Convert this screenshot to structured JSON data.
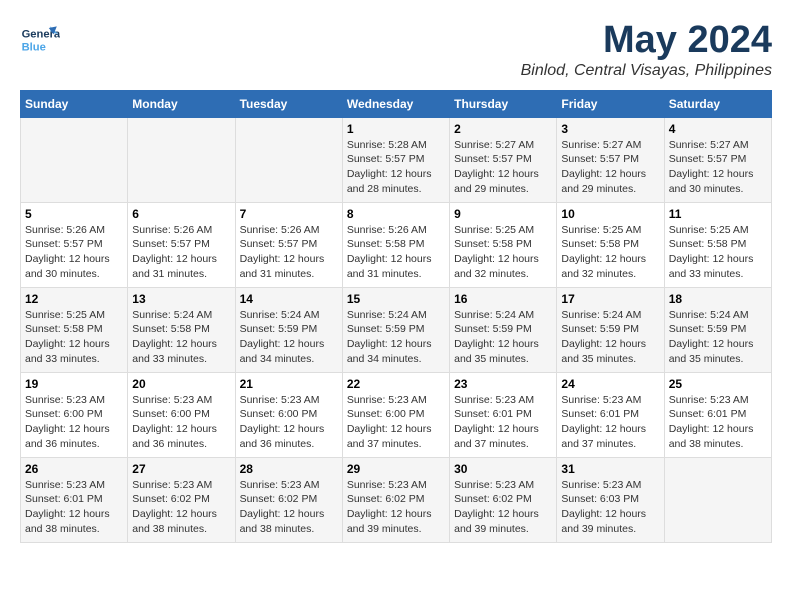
{
  "logo": {
    "general": "General",
    "blue": "Blue"
  },
  "header": {
    "title": "May 2024",
    "subtitle": "Binlod, Central Visayas, Philippines"
  },
  "weekdays": [
    "Sunday",
    "Monday",
    "Tuesday",
    "Wednesday",
    "Thursday",
    "Friday",
    "Saturday"
  ],
  "weeks": [
    [
      {
        "day": "",
        "info": ""
      },
      {
        "day": "",
        "info": ""
      },
      {
        "day": "",
        "info": ""
      },
      {
        "day": "1",
        "info": "Sunrise: 5:28 AM\nSunset: 5:57 PM\nDaylight: 12 hours\nand 28 minutes."
      },
      {
        "day": "2",
        "info": "Sunrise: 5:27 AM\nSunset: 5:57 PM\nDaylight: 12 hours\nand 29 minutes."
      },
      {
        "day": "3",
        "info": "Sunrise: 5:27 AM\nSunset: 5:57 PM\nDaylight: 12 hours\nand 29 minutes."
      },
      {
        "day": "4",
        "info": "Sunrise: 5:27 AM\nSunset: 5:57 PM\nDaylight: 12 hours\nand 30 minutes."
      }
    ],
    [
      {
        "day": "5",
        "info": "Sunrise: 5:26 AM\nSunset: 5:57 PM\nDaylight: 12 hours\nand 30 minutes."
      },
      {
        "day": "6",
        "info": "Sunrise: 5:26 AM\nSunset: 5:57 PM\nDaylight: 12 hours\nand 31 minutes."
      },
      {
        "day": "7",
        "info": "Sunrise: 5:26 AM\nSunset: 5:57 PM\nDaylight: 12 hours\nand 31 minutes."
      },
      {
        "day": "8",
        "info": "Sunrise: 5:26 AM\nSunset: 5:58 PM\nDaylight: 12 hours\nand 31 minutes."
      },
      {
        "day": "9",
        "info": "Sunrise: 5:25 AM\nSunset: 5:58 PM\nDaylight: 12 hours\nand 32 minutes."
      },
      {
        "day": "10",
        "info": "Sunrise: 5:25 AM\nSunset: 5:58 PM\nDaylight: 12 hours\nand 32 minutes."
      },
      {
        "day": "11",
        "info": "Sunrise: 5:25 AM\nSunset: 5:58 PM\nDaylight: 12 hours\nand 33 minutes."
      }
    ],
    [
      {
        "day": "12",
        "info": "Sunrise: 5:25 AM\nSunset: 5:58 PM\nDaylight: 12 hours\nand 33 minutes."
      },
      {
        "day": "13",
        "info": "Sunrise: 5:24 AM\nSunset: 5:58 PM\nDaylight: 12 hours\nand 33 minutes."
      },
      {
        "day": "14",
        "info": "Sunrise: 5:24 AM\nSunset: 5:59 PM\nDaylight: 12 hours\nand 34 minutes."
      },
      {
        "day": "15",
        "info": "Sunrise: 5:24 AM\nSunset: 5:59 PM\nDaylight: 12 hours\nand 34 minutes."
      },
      {
        "day": "16",
        "info": "Sunrise: 5:24 AM\nSunset: 5:59 PM\nDaylight: 12 hours\nand 35 minutes."
      },
      {
        "day": "17",
        "info": "Sunrise: 5:24 AM\nSunset: 5:59 PM\nDaylight: 12 hours\nand 35 minutes."
      },
      {
        "day": "18",
        "info": "Sunrise: 5:24 AM\nSunset: 5:59 PM\nDaylight: 12 hours\nand 35 minutes."
      }
    ],
    [
      {
        "day": "19",
        "info": "Sunrise: 5:23 AM\nSunset: 6:00 PM\nDaylight: 12 hours\nand 36 minutes."
      },
      {
        "day": "20",
        "info": "Sunrise: 5:23 AM\nSunset: 6:00 PM\nDaylight: 12 hours\nand 36 minutes."
      },
      {
        "day": "21",
        "info": "Sunrise: 5:23 AM\nSunset: 6:00 PM\nDaylight: 12 hours\nand 36 minutes."
      },
      {
        "day": "22",
        "info": "Sunrise: 5:23 AM\nSunset: 6:00 PM\nDaylight: 12 hours\nand 37 minutes."
      },
      {
        "day": "23",
        "info": "Sunrise: 5:23 AM\nSunset: 6:01 PM\nDaylight: 12 hours\nand 37 minutes."
      },
      {
        "day": "24",
        "info": "Sunrise: 5:23 AM\nSunset: 6:01 PM\nDaylight: 12 hours\nand 37 minutes."
      },
      {
        "day": "25",
        "info": "Sunrise: 5:23 AM\nSunset: 6:01 PM\nDaylight: 12 hours\nand 38 minutes."
      }
    ],
    [
      {
        "day": "26",
        "info": "Sunrise: 5:23 AM\nSunset: 6:01 PM\nDaylight: 12 hours\nand 38 minutes."
      },
      {
        "day": "27",
        "info": "Sunrise: 5:23 AM\nSunset: 6:02 PM\nDaylight: 12 hours\nand 38 minutes."
      },
      {
        "day": "28",
        "info": "Sunrise: 5:23 AM\nSunset: 6:02 PM\nDaylight: 12 hours\nand 38 minutes."
      },
      {
        "day": "29",
        "info": "Sunrise: 5:23 AM\nSunset: 6:02 PM\nDaylight: 12 hours\nand 39 minutes."
      },
      {
        "day": "30",
        "info": "Sunrise: 5:23 AM\nSunset: 6:02 PM\nDaylight: 12 hours\nand 39 minutes."
      },
      {
        "day": "31",
        "info": "Sunrise: 5:23 AM\nSunset: 6:03 PM\nDaylight: 12 hours\nand 39 minutes."
      },
      {
        "day": "",
        "info": ""
      }
    ]
  ]
}
